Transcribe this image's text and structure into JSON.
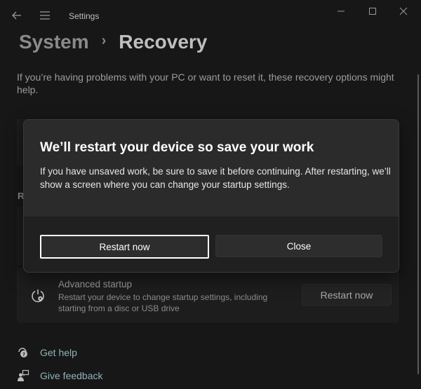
{
  "window": {
    "title": "Settings",
    "controls": {
      "minimize": "minimize-icon",
      "maximize": "maximize-icon",
      "close": "close-icon"
    }
  },
  "header": {
    "breadcrumb_parent": "System",
    "breadcrumb_separator": "›",
    "breadcrumb_current": "Recovery"
  },
  "intro": "If you’re having problems with your PC or want to reset it, these recovery options might help.",
  "background": {
    "section_letter": "R",
    "advanced_startup": {
      "title": "Advanced startup",
      "description": "Restart your device to change startup settings, including starting from a disc or USB drive",
      "button": "Restart now"
    },
    "links": [
      {
        "label": "Get help",
        "icon": "help-icon"
      },
      {
        "label": "Give feedback",
        "icon": "feedback-icon"
      }
    ]
  },
  "dialog": {
    "title": "We’ll restart your device so save your work",
    "body": "If you have unsaved work, be sure to save it before continuing. After restarting, we’ll show a screen where you can change your startup settings.",
    "primary_button": "Restart now",
    "secondary_button": "Close"
  },
  "colors": {
    "background": "#171717",
    "dialog": "#2b2b2b",
    "dialog_footer": "#202020",
    "link": "#8fb3b8"
  }
}
